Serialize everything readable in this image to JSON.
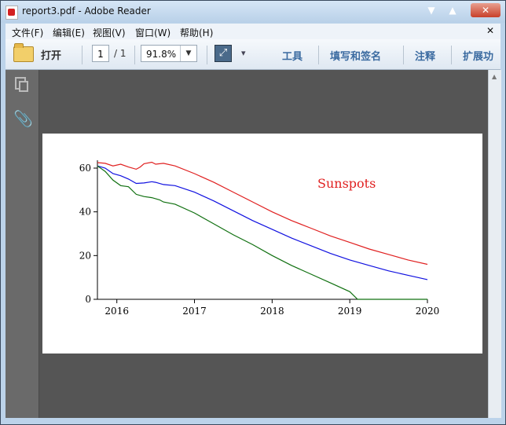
{
  "window": {
    "title": "report3.pdf - Adobe Reader"
  },
  "menu": [
    "文件(F)",
    "编辑(E)",
    "视图(V)",
    "窗口(W)",
    "帮助(H)"
  ],
  "toolbar": {
    "open_label": "打开",
    "page_current": "1",
    "page_total": "/ 1",
    "zoom": "91.8%",
    "links": [
      "工具",
      "填写和签名",
      "注释",
      "扩展功"
    ]
  },
  "icons": {
    "app": "pdf-icon",
    "folder": "folder-open-icon",
    "fit": "fit-page-icon",
    "more": "more-options-icon",
    "pages": "pages-panel-icon",
    "attach": "paperclip-icon",
    "close_menu": "close-icon"
  },
  "chart_data": {
    "type": "line",
    "title": "",
    "annotation": "Sunspots",
    "xlabel": "",
    "ylabel": "",
    "xlim": [
      2015.75,
      2020
    ],
    "ylim": [
      0,
      60
    ],
    "xticks": [
      2016,
      2017,
      2018,
      2019,
      2020
    ],
    "yticks": [
      0,
      20,
      40,
      60
    ],
    "grid": false,
    "legend": "none",
    "colors": {
      "red": "#e02020",
      "blue": "#1010e0",
      "green": "#107010"
    },
    "series": [
      {
        "color": "#e02020",
        "x": [
          2015.75,
          2015.85,
          2015.95,
          2016.05,
          2016.15,
          2016.25,
          2016.3,
          2016.35,
          2016.45,
          2016.5,
          2016.6,
          2016.75,
          2017.0,
          2017.25,
          2017.5,
          2017.75,
          2018.0,
          2018.25,
          2018.5,
          2018.75,
          2019.0,
          2019.25,
          2019.5,
          2019.75,
          2020.0
        ],
        "y": [
          62.5,
          62.2,
          61.0,
          61.8,
          60.5,
          59.5,
          60.5,
          62.0,
          62.7,
          61.8,
          62.2,
          61.0,
          57.5,
          53.5,
          49.0,
          44.5,
          40.0,
          36.0,
          32.5,
          29.0,
          26.0,
          23.0,
          20.5,
          18.0,
          16.0
        ]
      },
      {
        "color": "#1010e0",
        "x": [
          2015.75,
          2015.85,
          2015.95,
          2016.05,
          2016.15,
          2016.25,
          2016.35,
          2016.45,
          2016.5,
          2016.6,
          2016.75,
          2017.0,
          2017.25,
          2017.5,
          2017.75,
          2018.0,
          2018.25,
          2018.5,
          2018.75,
          2019.0,
          2019.25,
          2019.5,
          2019.75,
          2020.0
        ],
        "y": [
          61.0,
          60.0,
          57.5,
          56.5,
          55.0,
          53.0,
          53.2,
          53.8,
          53.5,
          52.5,
          52.0,
          49.0,
          45.0,
          40.5,
          36.0,
          32.0,
          28.0,
          24.5,
          21.0,
          18.0,
          15.5,
          13.0,
          11.0,
          9.0
        ]
      },
      {
        "color": "#107010",
        "x": [
          2015.75,
          2015.85,
          2015.95,
          2016.05,
          2016.15,
          2016.25,
          2016.35,
          2016.45,
          2016.55,
          2016.6,
          2016.75,
          2017.0,
          2017.25,
          2017.5,
          2017.75,
          2018.0,
          2018.25,
          2018.5,
          2018.75,
          2019.0,
          2019.1,
          2019.25,
          2019.5,
          2019.75,
          2020.0
        ],
        "y": [
          61.0,
          58.5,
          54.5,
          52.0,
          51.5,
          48.0,
          47.0,
          46.5,
          45.5,
          44.5,
          43.5,
          39.5,
          34.5,
          29.5,
          25.0,
          20.0,
          15.5,
          11.5,
          7.5,
          3.5,
          0.0,
          0.0,
          0.0,
          0.0,
          0.0
        ]
      }
    ]
  }
}
